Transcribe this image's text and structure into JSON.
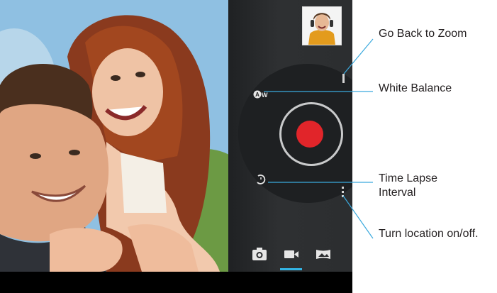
{
  "screen": {
    "accent_color": "#33b5e5",
    "record_color": "#e1252a",
    "panel_color": "#2b2d2f"
  },
  "controls": {
    "last_photo_thumbnail": "thumbnail-image",
    "shutter": "record-button",
    "white_balance_icon": "white-balance-auto-icon",
    "timelapse_icon": "timelapse-icon",
    "zoom_handle": "zoom-handle",
    "location_toggle": "location-icon"
  },
  "modes": [
    {
      "name": "camera-mode-icon",
      "active": false
    },
    {
      "name": "video-mode-icon",
      "active": true
    },
    {
      "name": "panorama-mode-icon",
      "active": false
    }
  ],
  "annotations": {
    "zoom": "Go Back to Zoom",
    "white_balance": "White Balance",
    "timelapse_line1": "Time Lapse",
    "timelapse_line2": "Interval",
    "location": "Turn location on/off."
  }
}
